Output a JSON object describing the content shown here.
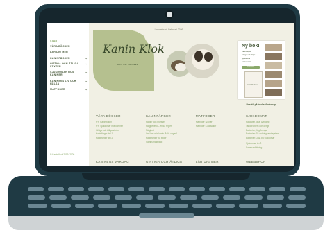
{
  "site": {
    "topbar": "Uppdaterad: Februari 2026",
    "logo_text": "Kanin Klok",
    "logo_sub": "ALLT OM KANINER"
  },
  "sidebar": {
    "items": [
      {
        "label": "START",
        "active": true,
        "has_children": false
      },
      {
        "label": "VÅRA BÖCKER",
        "active": false,
        "has_children": false
      },
      {
        "label": "LÄR DIG MER",
        "active": false,
        "has_children": false
      },
      {
        "label": "KANINFÄRGER",
        "active": false,
        "has_children": true
      },
      {
        "label": "GIFTIGA OCH ÄTLIGA VÄXTER",
        "active": false,
        "has_children": true
      },
      {
        "label": "SJUKDOMAR HOS KANINER",
        "active": false,
        "has_children": true
      },
      {
        "label": "KANINENS LIV OCH HÄLSA",
        "active": false,
        "has_children": true
      },
      {
        "label": "MATFODER",
        "active": false,
        "has_children": true
      }
    ],
    "footer": "© Kanin Klok 2019–2026",
    "chevron_icon": "chevron-down-icon"
  },
  "book": {
    "title": "Ny bok!",
    "bullets": [
      "Kaninfärger",
      "Giftiga och ätliga",
      "Sjukdomar",
      "Kaninens liv"
    ],
    "button": "KÖP BOK",
    "cover_title": "Kaninboken",
    "caption": "Beställ på bod.se/bokshop"
  },
  "columns": [
    {
      "heading": "VÅRA BÖCKER",
      "links": [
        "NY! Kaninboken",
        "NY! Sjukdomar hos kaniner",
        "Giftiga och ätliga växter",
        "Kaninfärger del 1",
        "Kaninfärger del 2"
      ]
    },
    {
      "heading": "KANINFÄRGER",
      "links": [
        "Färger och mönster",
        "Färggenetik – enkla regler",
        "Färgkort",
        "Vad kan min kanin få för ungar?",
        "Kaninfärger på bilder",
        "Sammanfattning"
      ]
    },
    {
      "heading": "MATFODER",
      "links": [
        "Matfoder: Växter",
        "Matfoder: Grönsaker"
      ]
    },
    {
      "heading": "SJUKDOMAR",
      "links": [
        "Parasiter, virus & svamp",
        "Tandproblem och övrigt",
        "Bakterier, förgiftningar",
        "Bakterier: Ett ordningsamt system",
        "Bakterier: Lista på sjukdomar",
        "Sjukdomar A–Ö",
        "Sammanfattning"
      ]
    }
  ],
  "row2": [
    "KANINENS VARDAG",
    "GIFTIGA OCH ÄTLIGA",
    "LÄR DIG MER",
    "WEBBSHOP"
  ]
}
